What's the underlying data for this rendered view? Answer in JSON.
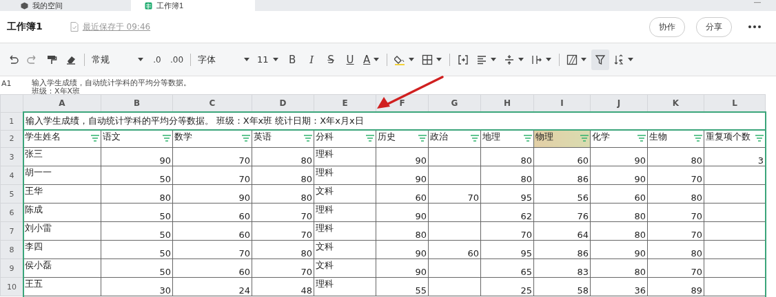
{
  "tabs": [
    {
      "label": "我的空间",
      "selected": false
    },
    {
      "label": "工作簿1",
      "selected": true
    }
  ],
  "document": {
    "title": "工作簿1",
    "saved": "最近保存于 09:46",
    "buttons": [
      "协作",
      "分享"
    ]
  },
  "toolbar": {
    "number_format": "常规",
    "decrease_decimal": ".0",
    "increase_decimal": ".00",
    "font": "字体",
    "font_size": "11",
    "bold": "B",
    "italic": "I",
    "strike": "S",
    "underline": "U",
    "font_color": "A",
    "filter_active": true
  },
  "formula_bar": {
    "cell": "A1",
    "content": "输入学生成绩，自动统计学科的平均分等数据。",
    "content_line_2": "班级：X年X班"
  },
  "sheet": {
    "columns": [
      {
        "letter": "A",
        "kind": "text"
      },
      {
        "letter": "B",
        "kind": "number"
      },
      {
        "letter": "C",
        "kind": "number"
      },
      {
        "letter": "D",
        "kind": "number"
      },
      {
        "letter": "E",
        "kind": "text"
      },
      {
        "letter": "F",
        "kind": "number"
      },
      {
        "letter": "G",
        "kind": "number"
      },
      {
        "letter": "H",
        "kind": "number"
      },
      {
        "letter": "I",
        "kind": "number"
      },
      {
        "letter": "J",
        "kind": "number"
      },
      {
        "letter": "K",
        "kind": "number"
      },
      {
        "letter": "L",
        "kind": "number"
      }
    ],
    "title_row": {
      "row_number": "1",
      "text": "输入学生成绩，自动统计学科的平均分等数据。 班级：X年x班  统计日期：X年x月x日"
    },
    "header_row": {
      "row_number": "2",
      "cells": [
        {
          "text": "学生姓名",
          "highlighted": false
        },
        {
          "text": "语文",
          "highlighted": false
        },
        {
          "text": "数学",
          "highlighted": false
        },
        {
          "text": "英语",
          "highlighted": false
        },
        {
          "text": "分科",
          "highlighted": false
        },
        {
          "text": "历史",
          "highlighted": false
        },
        {
          "text": "政治",
          "highlighted": false
        },
        {
          "text": "地理",
          "highlighted": false
        },
        {
          "text": "物理",
          "highlighted": true
        },
        {
          "text": "化学",
          "highlighted": false
        },
        {
          "text": "生物",
          "highlighted": false
        },
        {
          "text": "重复项个数",
          "highlighted": false
        }
      ]
    },
    "rows": [
      {
        "row_number": "3",
        "cells": [
          "张三",
          "90",
          "70",
          "80",
          "理科",
          "90",
          null,
          "80",
          "60",
          "90",
          "80",
          "3"
        ]
      },
      {
        "row_number": "4",
        "cells": [
          "胡一一",
          "50",
          "70",
          "80",
          "理科",
          "90",
          null,
          "80",
          "86",
          "90",
          "70",
          null
        ]
      },
      {
        "row_number": "5",
        "cells": [
          "王华",
          "80",
          "90",
          "80",
          "文科",
          "60",
          "70",
          "95",
          "56",
          "60",
          "80",
          null
        ]
      },
      {
        "row_number": "6",
        "cells": [
          "陈成",
          "50",
          "60",
          "70",
          "理科",
          "90",
          null,
          "62",
          "76",
          "80",
          "70",
          null
        ]
      },
      {
        "row_number": "7",
        "cells": [
          "刘小雷",
          "50",
          "60",
          "70",
          "理科",
          "80",
          null,
          "70",
          "64",
          "80",
          "70",
          null
        ]
      },
      {
        "row_number": "8",
        "cells": [
          "李四",
          "50",
          "70",
          "80",
          "文科",
          "90",
          "60",
          "95",
          "86",
          "90",
          "80",
          null
        ]
      },
      {
        "row_number": "9",
        "cells": [
          "侯小磊",
          "50",
          "60",
          "70",
          "文科",
          "90",
          null,
          "65",
          "83",
          "80",
          "70",
          null
        ]
      },
      {
        "row_number": "10",
        "cells": [
          "王五",
          "30",
          "24",
          "48",
          "理科",
          "55",
          null,
          "25",
          "58",
          "36",
          "89",
          null
        ]
      }
    ]
  }
}
